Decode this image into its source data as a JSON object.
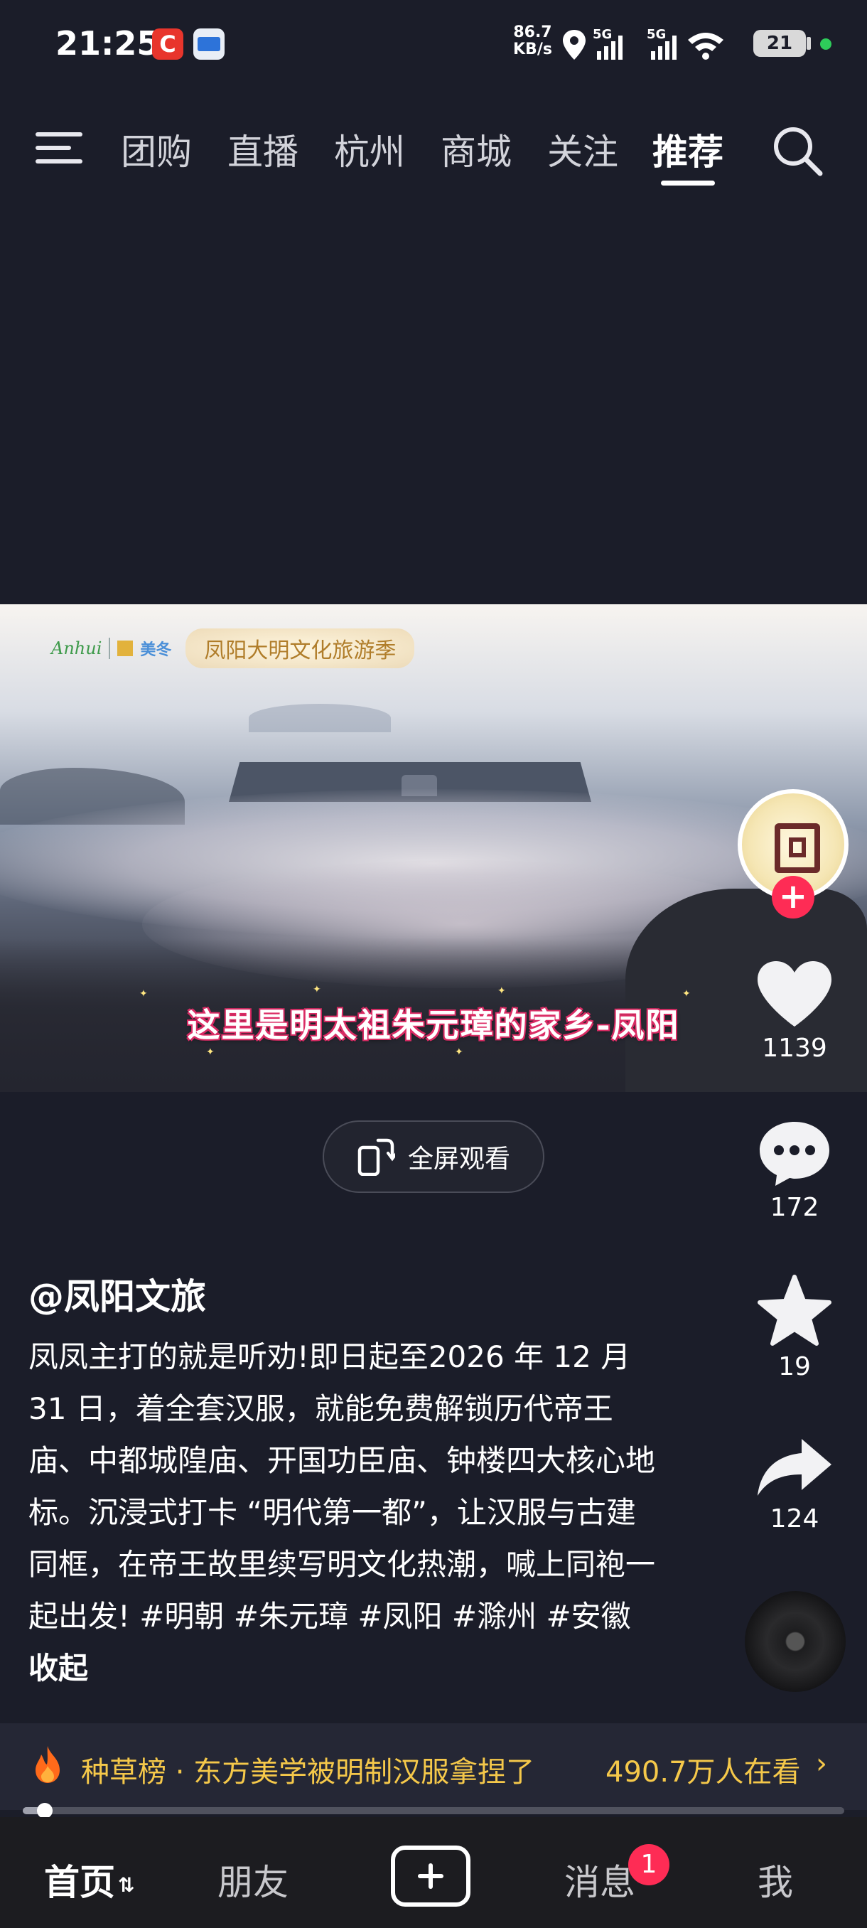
{
  "status_bar": {
    "time": "21:25",
    "app_badge_c": "C",
    "net_speed_value": "86.7",
    "net_speed_unit": "KB/s",
    "signal_1": "5G",
    "signal_2": "5G",
    "battery_level": "21"
  },
  "top_nav": {
    "tabs": [
      {
        "label": "团购",
        "active": false
      },
      {
        "label": "直播",
        "active": false
      },
      {
        "label": "杭州",
        "active": false
      },
      {
        "label": "商城",
        "active": false
      },
      {
        "label": "关注",
        "active": false
      },
      {
        "label": "推荐",
        "active": true
      }
    ]
  },
  "video": {
    "logo_text": "Anhui",
    "logo_sponsor": "美冬",
    "banner_text": "凤阳大明文化旅游季",
    "subtitle": "这里是明太祖朱元璋的家乡-凤阳"
  },
  "actions": {
    "likes": "1139",
    "comments": "172",
    "favorites": "19",
    "shares": "124"
  },
  "fullscreen_label": "全屏观看",
  "post": {
    "author": "@凤阳文旅",
    "description_text": "凤凤主打的就是听劝!即日起至2026 年 12 月 31 日，着全套汉服，就能免费解锁历代帝王庙、中都城隍庙、开国功臣庙、钟楼四大核心地标。沉浸式打卡 “明代第一都”，让汉服与古建同框，在帝王故里续写明文化热潮，喊上同袍一起出发! ",
    "tags": [
      "#明朝",
      "#朱元璋",
      "#凤阳",
      "#滁州",
      "#安徽"
    ],
    "collapse_label": "收起"
  },
  "trending": {
    "title": "种草榜 · 东方美学被明制汉服拿捏了",
    "count": "490.7万人在看",
    "arrow": "›"
  },
  "playback": {
    "progress": 0.03
  },
  "tab_bar": {
    "home": "首页",
    "home_arrows": "⇅",
    "friends": "朋友",
    "messages": "消息",
    "messages_badge": "1",
    "me": "我"
  },
  "colors": {
    "background": "#1b1d29",
    "accent_red": "#fe2c55",
    "trend_yellow": "#f5c84a"
  }
}
